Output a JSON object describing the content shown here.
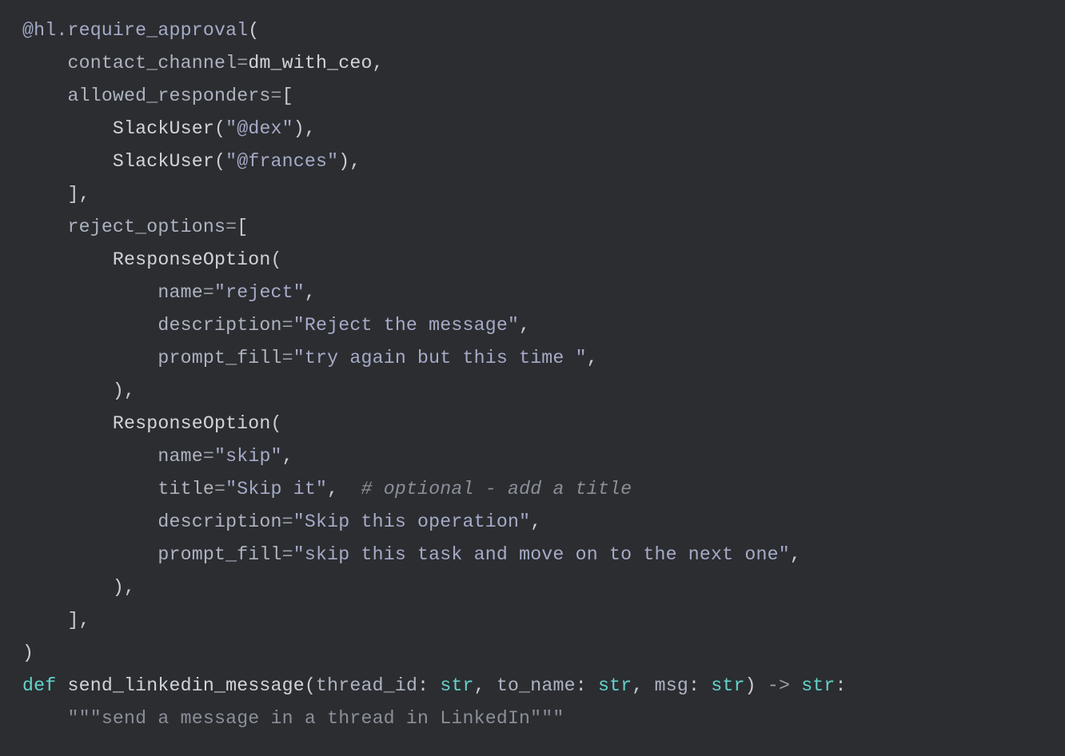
{
  "code": {
    "decorator": "@hl.require_approval",
    "contact_channel_key": "contact_channel",
    "contact_channel_val": "dm_with_ceo",
    "allowed_key": "allowed_responders",
    "slack_user": "SlackUser",
    "responder1": "\"@dex\"",
    "responder2": "\"@frances\"",
    "reject_key": "reject_options",
    "response_option": "ResponseOption",
    "name_key": "name",
    "name_reject": "\"reject\"",
    "description_key": "description",
    "description_reject": "\"Reject the message\"",
    "prompt_fill_key": "prompt_fill",
    "prompt_fill_try": "\"try again but this time \"",
    "name_skip": "\"skip\"",
    "title_key": "title",
    "title_skip": "\"Skip it\"",
    "comment_title": "# optional - add a title",
    "description_skip": "\"Skip this operation\"",
    "prompt_fill_skip": "\"skip this task and move on to the next one\"",
    "def_kw": "def",
    "func_name": "send_linkedin_message",
    "param1": "thread_id",
    "param2": "to_name",
    "param3": "msg",
    "str_type": "str",
    "arrow": "->",
    "docstring": "\"\"\"send a message in a thread in LinkedIn\"\"\""
  }
}
